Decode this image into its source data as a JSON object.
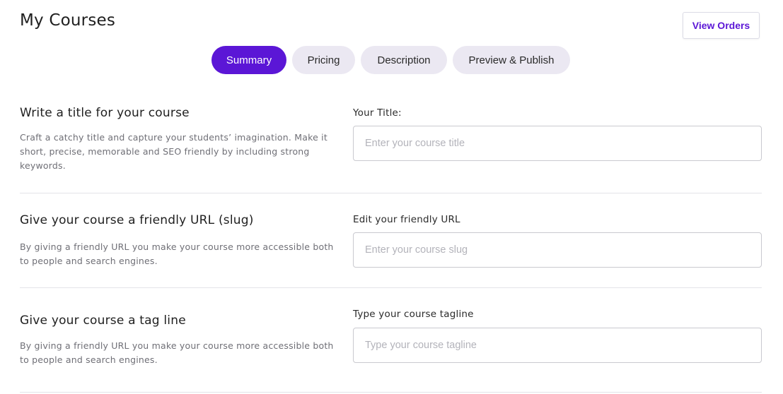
{
  "header": {
    "title": "My Courses",
    "view_orders_label": "View Orders"
  },
  "tabs": [
    {
      "label": "Summary",
      "active": true
    },
    {
      "label": "Pricing",
      "active": false
    },
    {
      "label": "Description",
      "active": false
    },
    {
      "label": "Preview & Publish",
      "active": false
    }
  ],
  "sections": [
    {
      "heading": "Write a title for your course",
      "description": "Craft a catchy title and capture your students’ imagination. Make it short, precise, memorable and SEO friendly by including strong keywords.",
      "field_label": "Your Title:",
      "placeholder": "Enter your course title",
      "value": ""
    },
    {
      "heading": "Give your course a friendly URL (slug)",
      "description": "By giving a friendly URL you make your course more accessible both to people and search engines.",
      "field_label": "Edit your friendly URL",
      "placeholder": "Enter your course slug",
      "value": ""
    },
    {
      "heading": "Give your course a tag line",
      "description": "By giving a friendly URL you make your course more accessible both to people and search engines.",
      "field_label": "Type your course tagline",
      "placeholder": "Type your course tagline",
      "value": ""
    }
  ],
  "colors": {
    "accent": "#5b16d6",
    "tab_inactive_bg": "#ebe8f2",
    "divider": "#e3e3e8"
  }
}
